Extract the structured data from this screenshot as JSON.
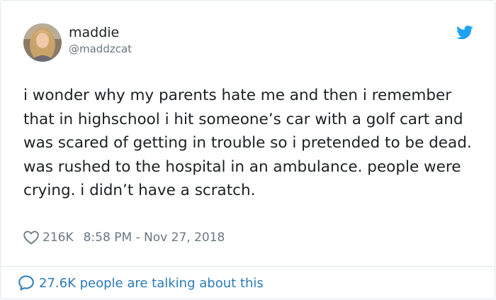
{
  "author": {
    "display_name": "maddie",
    "handle": "@maddzcat"
  },
  "tweet": {
    "text": "i wonder why my parents hate me and then i remember that in highschool i hit someone’s car with a golf cart and was scared of getting in trouble so i pretended to be dead. was rushed to the hospital in an ambulance. people were crying. i didn’t have a scratch.",
    "likes": "216K",
    "timestamp": "8:58 PM - Nov 27, 2018"
  },
  "footer": {
    "conversation_label": "27.6K people are talking about this"
  },
  "icons": {
    "brand": "twitter-bird-icon",
    "like": "heart-icon",
    "conversation": "speech-bubble-icon"
  },
  "colors": {
    "brand_blue": "#1da1f2",
    "link_blue": "#2b7bb9",
    "text": "#1c2022",
    "muted": "#697882",
    "border": "#e1e8ed"
  }
}
